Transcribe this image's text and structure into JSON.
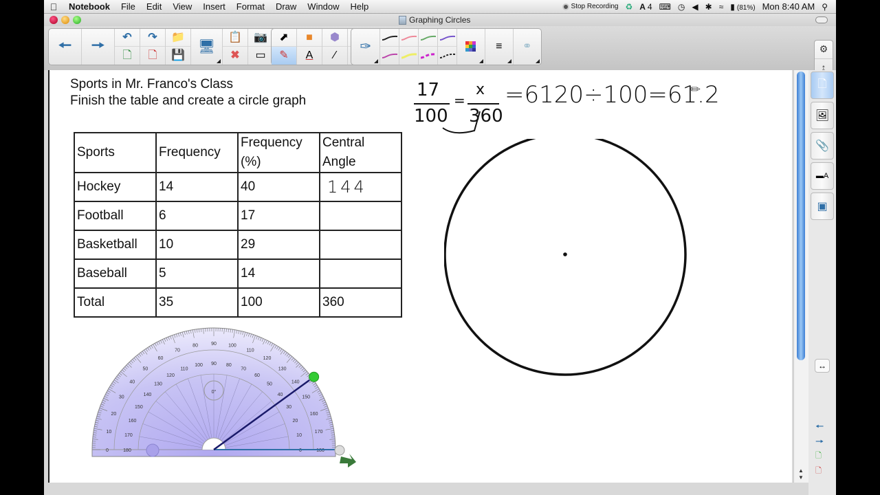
{
  "menubar": {
    "apple_icon": "apple-logo-icon",
    "app_name": "Notebook",
    "menus": [
      "File",
      "Edit",
      "View",
      "Insert",
      "Format",
      "Draw",
      "Window",
      "Help"
    ],
    "status": {
      "recording": "Stop Recording",
      "adobe_count": "4",
      "battery": "(81%)",
      "clock": "Mon 8:40 AM"
    }
  },
  "window": {
    "title": "Graphing Circles"
  },
  "toolbar": {
    "colors": {
      "accent_blue": "#2f6fa7",
      "selected_bg": "#a9ccf1"
    },
    "groups": [
      {
        "name": "navigation",
        "tools": [
          "previous-page",
          "next-page"
        ]
      },
      {
        "name": "file",
        "tools": [
          "undo",
          "redo",
          "open-file",
          "add-page",
          "delete-page",
          "save"
        ]
      },
      {
        "name": "display",
        "tools": [
          "screen-shade"
        ]
      },
      {
        "name": "insert",
        "tools": [
          "paste",
          "screen-capture",
          "document-camera",
          "measurement-tools",
          "delete",
          "table-view",
          "insert-table",
          "close-tools"
        ]
      },
      {
        "name": "draw",
        "tools": [
          "select",
          "shapes",
          "eraser-shapes",
          "fill",
          "pens",
          "text",
          "line",
          "eraser"
        ]
      },
      {
        "name": "pen-properties",
        "tools": [
          "pen",
          "stroke-black",
          "stroke-pink",
          "stroke-green",
          "stroke-purple",
          "stroke-magenta",
          "stroke-yellow",
          "stroke-dash-magenta",
          "stroke-dash-black",
          "color-palette",
          "line-style",
          "transparency"
        ]
      }
    ]
  },
  "side_panel": {
    "tabs": [
      "page-sorter",
      "gallery",
      "attachments",
      "properties",
      "add-ons"
    ],
    "selected_tab": "page-sorter"
  },
  "document": {
    "title": "Sports in Mr. Franco's Class",
    "instruction": "Finish the table and create a circle graph",
    "table": {
      "headers": [
        "Sports",
        "Frequency",
        "Frequency (%)",
        "Central Angle"
      ],
      "rows": [
        [
          "Hockey",
          "14",
          "40",
          "144"
        ],
        [
          "Football",
          "6",
          "17",
          ""
        ],
        [
          "Basketball",
          "10",
          "29",
          ""
        ],
        [
          "Baseball",
          "5",
          "14",
          ""
        ],
        [
          "Total",
          "35",
          "100",
          "360"
        ]
      ]
    },
    "handwriting": {
      "fraction1_num": "17",
      "fraction1_den": "100",
      "fraction2_num": "x",
      "fraction2_den": "360",
      "equation": "=6120÷100=61.2"
    },
    "protractor": {
      "outer_labels": [
        "0",
        "10",
        "20",
        "30",
        "40",
        "50",
        "60",
        "70",
        "80",
        "90",
        "100",
        "110",
        "120",
        "130",
        "140",
        "150",
        "160",
        "170",
        "180"
      ],
      "inner_labels": [
        "180",
        "170",
        "160",
        "150",
        "140",
        "130",
        "120",
        "110",
        "100",
        "90",
        "80",
        "70",
        "60",
        "50",
        "40",
        "30",
        "20",
        "10",
        "0"
      ],
      "center_readout": "0°",
      "measured_angle_deg": 36
    }
  }
}
